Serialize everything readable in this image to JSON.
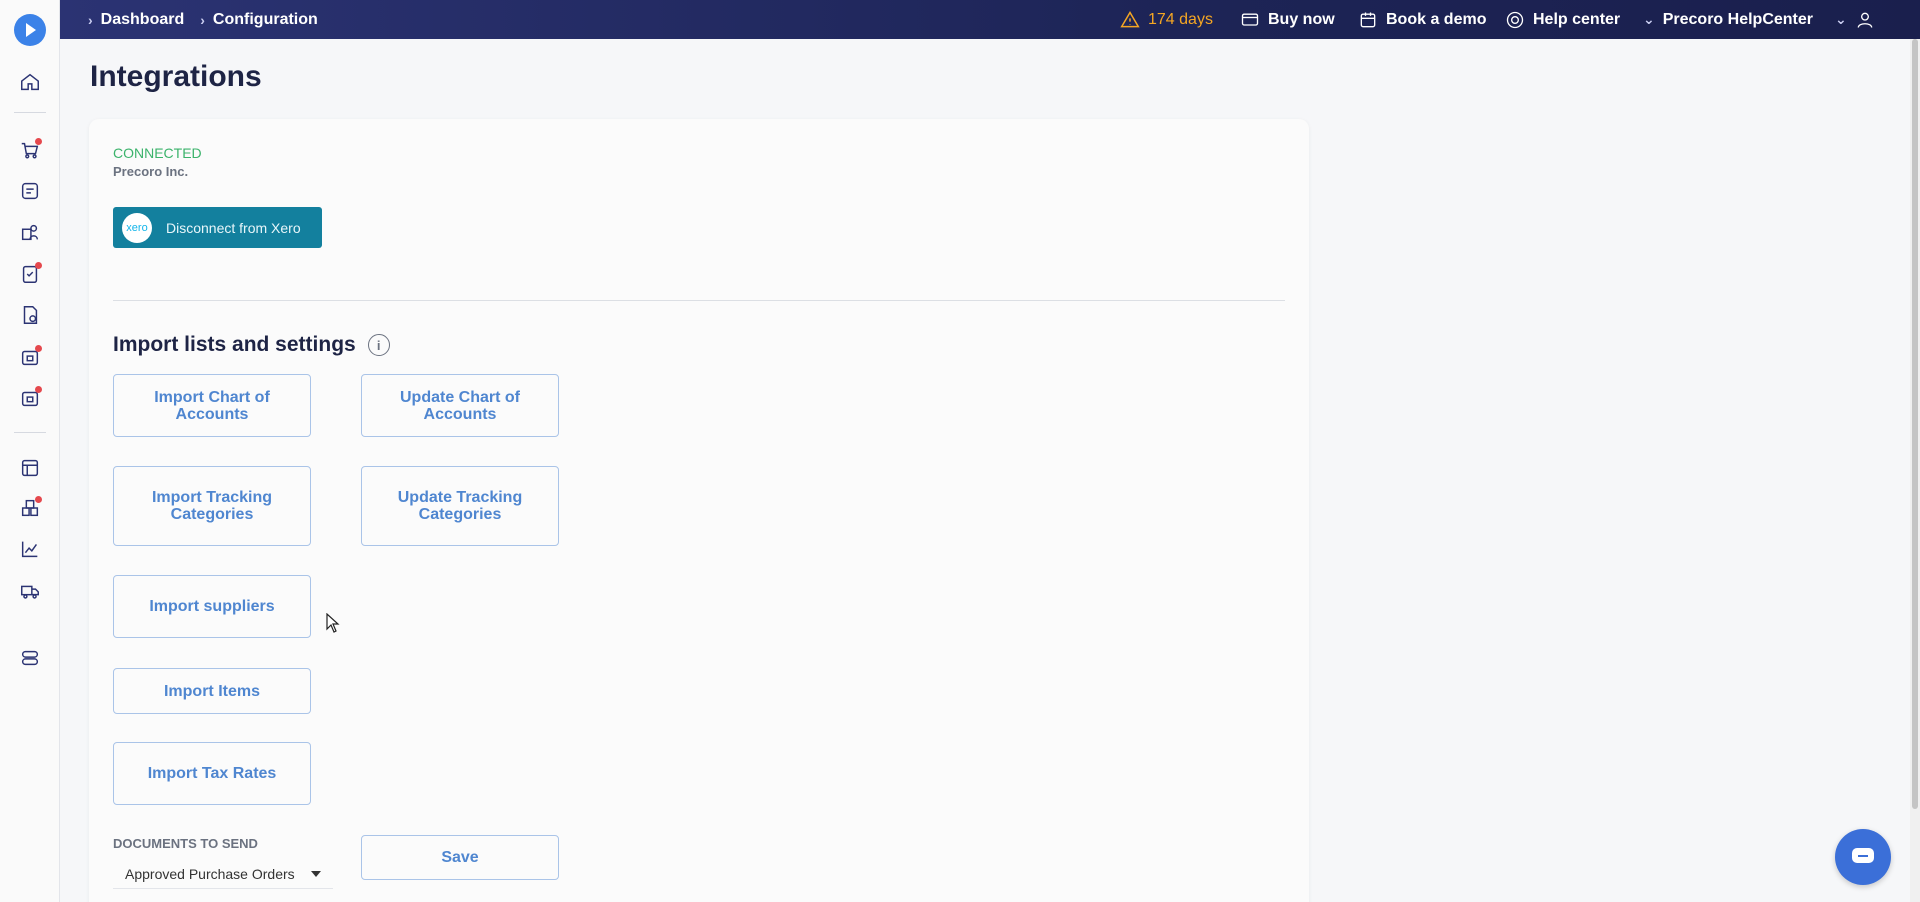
{
  "breadcrumb": {
    "items": [
      "Dashboard",
      "Configuration"
    ]
  },
  "topbar": {
    "trial_days": "174 days",
    "buy_now": "Buy now",
    "book_demo": "Book a demo",
    "help_center": "Help center",
    "account": "Precoro HelpCenter"
  },
  "page": {
    "title": "Integrations"
  },
  "integration": {
    "status": "CONNECTED",
    "company": "Precoro Inc.",
    "xero_logo_text": "xero",
    "disconnect_label": "Disconnect from Xero"
  },
  "import_section": {
    "title": "Import lists and settings",
    "info_glyph": "i",
    "buttons": {
      "import_chart": "Import Chart of Accounts",
      "update_chart": "Update Chart of Accounts",
      "import_tracking": "Import Tracking Categories",
      "update_tracking": "Update Tracking Categories",
      "import_suppliers": "Import suppliers",
      "import_items": "Import Items",
      "import_tax": "Import Tax Rates"
    }
  },
  "documents": {
    "label": "DOCUMENTS TO SEND",
    "selected": "Approved Purchase Orders",
    "save_label": "Save"
  },
  "colors": {
    "topbar": "#1d2456",
    "accent": "#4f86d0",
    "connected": "#3bb36b",
    "xero": "#13809e",
    "warning": "#f5a623"
  }
}
